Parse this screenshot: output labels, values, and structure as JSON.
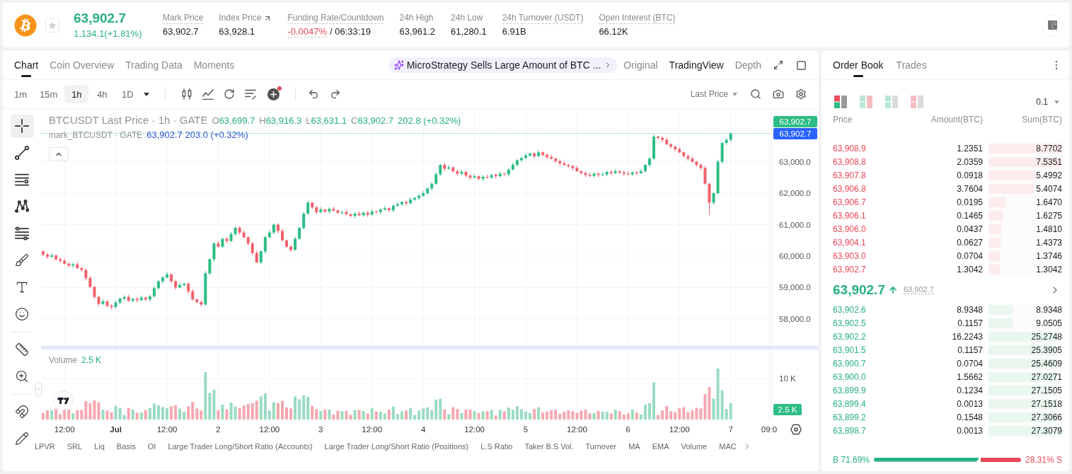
{
  "ticker": {
    "starred": false,
    "price": "63,902.7",
    "change": "1,134.1(+1.81%)",
    "stats": [
      {
        "label": "Mark Price",
        "value": "63,902.7",
        "kind": "tooltip"
      },
      {
        "label": "Index Price",
        "value": "63,928.1",
        "kind": "link"
      },
      {
        "label": "Funding Rate/Countdown",
        "value": "-0.0047%",
        "countdown": "/ 06:33:19",
        "kind": "funding"
      },
      {
        "label": "24h High",
        "value": "63,961.2",
        "kind": "plain"
      },
      {
        "label": "24h Low",
        "value": "61,280.1",
        "kind": "plain"
      },
      {
        "label": "24h Turnover (USDT)",
        "value": "6.91B",
        "kind": "tooltip"
      },
      {
        "label": "Open Interest (BTC)",
        "value": "66.12K",
        "kind": "tooltip"
      }
    ]
  },
  "chart_panel": {
    "tabs": [
      {
        "label": "Chart",
        "selected": true
      },
      {
        "label": "Coin Overview",
        "selected": false
      },
      {
        "label": "Trading Data",
        "selected": false
      },
      {
        "label": "Moments",
        "selected": false
      }
    ],
    "news": "MicroStrategy Sells Large Amount of BTC ...",
    "views": [
      {
        "label": "Original",
        "selected": false
      },
      {
        "label": "TradingView",
        "selected": true
      },
      {
        "label": "Depth",
        "selected": false
      }
    ]
  },
  "toolbar": {
    "intervals": [
      {
        "label": "1m",
        "selected": false
      },
      {
        "label": "15m",
        "selected": false
      },
      {
        "label": "1h",
        "selected": true
      },
      {
        "label": "4h",
        "selected": false
      },
      {
        "label": "1D",
        "selected": false
      }
    ],
    "new_badge": true,
    "price_source": "Last Price"
  },
  "drawing_tool_groups": [
    {
      "tools": [
        {
          "selected": true
        },
        {
          "selected": false
        },
        {
          "selected": false
        },
        {
          "selected": false
        },
        {
          "selected": false
        },
        {
          "selected": false
        },
        {
          "selected": false
        },
        {
          "selected": false
        }
      ]
    },
    {
      "tools": [
        {
          "selected": false
        },
        {
          "selected": false
        }
      ]
    },
    {
      "tools": [
        {
          "selected": false
        },
        {
          "selected": false
        }
      ]
    }
  ],
  "legend": {
    "title": "BTCUSDT Last Price · 1h · GATE",
    "ohlc": [
      {
        "key": "O",
        "value": "63,699.7"
      },
      {
        "key": "H",
        "value": "63,916.3"
      },
      {
        "key": "L",
        "value": "63,631.1"
      },
      {
        "key": "C",
        "value": "63,902.7"
      }
    ],
    "change": "202.8 (+0.32%)",
    "mark_title": "mark_BTCUSDT · GATE",
    "mark_values": "63,902.7 203.0 (+0.32%)"
  },
  "price_chart": {
    "chart_data": {
      "type": "candlestick",
      "categories": [
        null,
        null,
        null,
        null,
        null,
        "12:00",
        null,
        null,
        null,
        null,
        null,
        null,
        null,
        null,
        null,
        null,
        null,
        "Jul",
        null,
        null,
        null,
        null,
        null,
        null,
        null,
        null,
        null,
        null,
        null,
        "12:00",
        null,
        null,
        null,
        null,
        null,
        null,
        null,
        null,
        null,
        null,
        null,
        "2",
        null,
        null,
        null,
        null,
        null,
        null,
        null,
        null,
        null,
        null,
        null,
        "12:00",
        null,
        null,
        null,
        null,
        null,
        null,
        null,
        null,
        null,
        null,
        null,
        "3",
        null,
        null,
        null,
        null,
        null,
        null,
        null,
        null,
        null,
        null,
        null,
        "12:00",
        null,
        null,
        null,
        null,
        null,
        null,
        null,
        null,
        null,
        null,
        null,
        "4",
        null,
        null,
        null,
        null,
        null,
        null,
        null,
        null,
        null,
        null,
        null,
        "12:00",
        null,
        null,
        null,
        null,
        null,
        null,
        null,
        null,
        null,
        null,
        null,
        "5",
        null,
        null,
        null,
        null,
        null,
        null,
        null,
        null,
        null,
        null,
        null,
        "12:00",
        null,
        null,
        null,
        null,
        null,
        null,
        null,
        null,
        null,
        null,
        null,
        "6",
        null,
        null,
        null,
        null,
        null,
        null,
        null,
        null,
        null,
        null,
        null,
        "12:00",
        null,
        null,
        null,
        null,
        null,
        null,
        null,
        null,
        null,
        null,
        null,
        "7",
        null,
        null,
        null,
        null,
        null,
        null,
        null,
        null,
        "09:0"
      ],
      "ohlc": [
        [
          60150,
          60180,
          60000,
          60050
        ],
        [
          60050,
          60100,
          59910,
          59980
        ],
        [
          59980,
          60090,
          59950,
          60020
        ],
        [
          60020,
          60050,
          59850,
          59900
        ],
        [
          59900,
          59950,
          59780,
          59850
        ],
        [
          59850,
          59920,
          59730,
          59760
        ],
        [
          59760,
          59790,
          59650,
          59700
        ],
        [
          59700,
          59790,
          59630,
          59740
        ],
        [
          59740,
          59810,
          59590,
          59620
        ],
        [
          59620,
          59650,
          59510,
          59560
        ],
        [
          59560,
          59610,
          59230,
          59300
        ],
        [
          59300,
          59370,
          58990,
          59020
        ],
        [
          59020,
          59050,
          58650,
          58700
        ],
        [
          58700,
          58750,
          58410,
          58480
        ],
        [
          58480,
          58630,
          58450,
          58560
        ],
        [
          58560,
          58590,
          58370,
          58420
        ],
        [
          58420,
          58470,
          58310,
          58380
        ],
        [
          58380,
          58590,
          58350,
          58520
        ],
        [
          58520,
          58680,
          58470,
          58650
        ],
        [
          58650,
          58750,
          58580,
          58700
        ],
        [
          58700,
          58770,
          58550,
          58580
        ],
        [
          58580,
          58670,
          58530,
          58640
        ],
        [
          58640,
          58690,
          58530,
          58600
        ],
        [
          58600,
          58750,
          58570,
          58680
        ],
        [
          58680,
          58710,
          58570,
          58620
        ],
        [
          58620,
          58770,
          58550,
          58720
        ],
        [
          58720,
          59050,
          58690,
          58980
        ],
        [
          58980,
          59230,
          58930,
          59200
        ],
        [
          59200,
          59370,
          59130,
          59320
        ],
        [
          59320,
          59490,
          59290,
          59420
        ],
        [
          59420,
          59450,
          59150,
          59200
        ],
        [
          59200,
          59250,
          58930,
          59000
        ],
        [
          59000,
          59150,
          58970,
          59080
        ],
        [
          59080,
          59150,
          59030,
          59120
        ],
        [
          59120,
          59170,
          58810,
          58880
        ],
        [
          58880,
          58950,
          58590,
          58620
        ],
        [
          58620,
          58650,
          58490,
          58540
        ],
        [
          58540,
          58590,
          58390,
          58460
        ],
        [
          58460,
          59520,
          58430,
          59450
        ],
        [
          59450,
          59930,
          59400,
          59900
        ],
        [
          59900,
          60450,
          59830,
          60400
        ],
        [
          60400,
          60470,
          60270,
          60300
        ],
        [
          60300,
          60580,
          60250,
          60550
        ],
        [
          60550,
          60600,
          60410,
          60480
        ],
        [
          60480,
          60770,
          60450,
          60700
        ],
        [
          60700,
          60930,
          60650,
          60900
        ],
        [
          60900,
          60950,
          60680,
          60750
        ],
        [
          60750,
          60820,
          60570,
          60600
        ],
        [
          60600,
          60630,
          60350,
          60400
        ],
        [
          60400,
          60450,
          60030,
          60100
        ],
        [
          60100,
          60170,
          59770,
          59800
        ],
        [
          59800,
          60180,
          59750,
          60150
        ],
        [
          60150,
          60650,
          60080,
          60600
        ],
        [
          60600,
          60820,
          60570,
          60750
        ],
        [
          60750,
          61030,
          60700,
          61000
        ],
        [
          61000,
          61050,
          60730,
          60800
        ],
        [
          60800,
          60870,
          60470,
          60500
        ],
        [
          60500,
          60530,
          60250,
          60300
        ],
        [
          60300,
          60350,
          60130,
          60200
        ],
        [
          60200,
          60620,
          60170,
          60550
        ],
        [
          60550,
          60930,
          60500,
          60900
        ],
        [
          60900,
          61400,
          60830,
          61350
        ],
        [
          61350,
          61770,
          61320,
          61700
        ],
        [
          61700,
          61730,
          61500,
          61550
        ],
        [
          61550,
          61600,
          61330,
          61400
        ],
        [
          61400,
          61550,
          61370,
          61480
        ],
        [
          61480,
          61510,
          61370,
          61420
        ],
        [
          61420,
          61550,
          61350,
          61500
        ],
        [
          61500,
          61570,
          61420,
          61450
        ],
        [
          61450,
          61480,
          61330,
          61380
        ],
        [
          61380,
          61450,
          61310,
          61400
        ],
        [
          61400,
          61470,
          61300,
          61330
        ],
        [
          61330,
          61360,
          61230,
          61280
        ],
        [
          61280,
          61400,
          61210,
          61350
        ],
        [
          61350,
          61420,
          61270,
          61300
        ],
        [
          61300,
          61410,
          61250,
          61380
        ],
        [
          61380,
          61430,
          61250,
          61320
        ],
        [
          61320,
          61490,
          61290,
          61420
        ],
        [
          61420,
          61450,
          61350,
          61400
        ],
        [
          61400,
          61530,
          61330,
          61480
        ],
        [
          61480,
          61590,
          61450,
          61520
        ],
        [
          61520,
          61550,
          61410,
          61460
        ],
        [
          61460,
          61650,
          61390,
          61600
        ],
        [
          61600,
          61720,
          61570,
          61650
        ],
        [
          61650,
          61750,
          61600,
          61720
        ],
        [
          61720,
          61770,
          61610,
          61680
        ],
        [
          61680,
          61870,
          61650,
          61800
        ],
        [
          61800,
          61880,
          61750,
          61850
        ],
        [
          61850,
          61970,
          61780,
          61920
        ],
        [
          61920,
          62070,
          61890,
          62000
        ],
        [
          62000,
          62180,
          61950,
          62150
        ],
        [
          62150,
          62350,
          62080,
          62300
        ],
        [
          62300,
          62670,
          62270,
          62600
        ],
        [
          62600,
          62930,
          62550,
          62900
        ],
        [
          62900,
          62950,
          62710,
          62780
        ],
        [
          62780,
          62890,
          62750,
          62820
        ],
        [
          62820,
          62850,
          62650,
          62700
        ],
        [
          62700,
          62750,
          62550,
          62620
        ],
        [
          62620,
          62750,
          62590,
          62680
        ],
        [
          62680,
          62710,
          62510,
          62560
        ],
        [
          62560,
          62610,
          62430,
          62500
        ],
        [
          62500,
          62610,
          62470,
          62540
        ],
        [
          62540,
          62570,
          62410,
          62460
        ],
        [
          62460,
          62570,
          62390,
          62520
        ],
        [
          62520,
          62590,
          62470,
          62500
        ],
        [
          62500,
          62610,
          62450,
          62580
        ],
        [
          62580,
          62630,
          62470,
          62540
        ],
        [
          62540,
          62690,
          62510,
          62620
        ],
        [
          62620,
          62650,
          62550,
          62600
        ],
        [
          62600,
          62800,
          62530,
          62750
        ],
        [
          62750,
          62970,
          62720,
          62900
        ],
        [
          62900,
          63080,
          62850,
          63050
        ],
        [
          63050,
          63170,
          62980,
          63120
        ],
        [
          63120,
          63270,
          63090,
          63200
        ],
        [
          63200,
          63290,
          63150,
          63260
        ],
        [
          63260,
          63310,
          63110,
          63180
        ],
        [
          63180,
          63370,
          63150,
          63300
        ],
        [
          63300,
          63330,
          63170,
          63220
        ],
        [
          63220,
          63270,
          63080,
          63150
        ],
        [
          63150,
          63220,
          63070,
          63100
        ],
        [
          63100,
          63130,
          62970,
          63020
        ],
        [
          63020,
          63070,
          62880,
          62950
        ],
        [
          62950,
          63020,
          62870,
          62900
        ],
        [
          62900,
          62930,
          62810,
          62860
        ],
        [
          62860,
          62910,
          62730,
          62800
        ],
        [
          62800,
          62870,
          62670,
          62700
        ],
        [
          62700,
          62730,
          62590,
          62640
        ],
        [
          62640,
          62690,
          62510,
          62580
        ],
        [
          62580,
          62650,
          62520,
          62550
        ],
        [
          62550,
          62650,
          62500,
          62620
        ],
        [
          62620,
          62670,
          62510,
          62580
        ],
        [
          62580,
          62670,
          62550,
          62600
        ],
        [
          62600,
          62710,
          62550,
          62680
        ],
        [
          62680,
          62730,
          62570,
          62640
        ],
        [
          62640,
          62770,
          62610,
          62700
        ],
        [
          62700,
          62730,
          62610,
          62660
        ],
        [
          62660,
          62710,
          62550,
          62620
        ],
        [
          62620,
          62690,
          62570,
          62600
        ],
        [
          62600,
          62690,
          62550,
          62660
        ],
        [
          62660,
          62710,
          62570,
          62640
        ],
        [
          62640,
          62770,
          62610,
          62700
        ],
        [
          62700,
          62930,
          62650,
          62900
        ],
        [
          62900,
          63150,
          62830,
          63100
        ],
        [
          63100,
          63870,
          63070,
          63800
        ],
        [
          63800,
          63830,
          63710,
          63760
        ],
        [
          63760,
          63810,
          63630,
          63700
        ],
        [
          63700,
          63770,
          63530,
          63560
        ],
        [
          63560,
          63590,
          63430,
          63480
        ],
        [
          63480,
          63530,
          63330,
          63400
        ],
        [
          63400,
          63470,
          63270,
          63300
        ],
        [
          63300,
          63330,
          63130,
          63180
        ],
        [
          63180,
          63230,
          63030,
          63100
        ],
        [
          63100,
          63170,
          62970,
          63000
        ],
        [
          63000,
          63030,
          62850,
          62900
        ],
        [
          62900,
          62950,
          62730,
          62800
        ],
        [
          62800,
          62870,
          62270,
          62300
        ],
        [
          62300,
          62330,
          61300,
          61700
        ],
        [
          61700,
          62050,
          61630,
          62000
        ],
        [
          62000,
          63070,
          61970,
          63000
        ],
        [
          63000,
          63630,
          62950,
          63600
        ],
        [
          63600,
          63750,
          63530,
          63699.7
        ],
        [
          63699.7,
          63916.3,
          63631.1,
          63902.7
        ],
        null,
        null,
        null,
        null,
        null,
        null,
        null,
        null,
        null
      ],
      "ylim": [
        54780,
        64680
      ],
      "grid": true,
      "yticks": [
        {
          "value": 63000,
          "label": "63,000.0"
        },
        {
          "value": 62000,
          "label": "62,000.0"
        },
        {
          "value": 61000,
          "label": "61,000.0"
        },
        {
          "value": 60000,
          "label": "60,000.0"
        },
        {
          "value": 59000,
          "label": "59,000.0"
        },
        {
          "value": 58000,
          "label": "58,000.0"
        }
      ],
      "ref_lines": [
        {
          "axis": "y",
          "value": 63902.7,
          "label": "63,902.7"
        }
      ]
    },
    "x_label_emphasis": [
      false,
      true,
      false,
      false,
      false,
      false,
      false,
      false,
      false,
      false,
      false,
      false,
      false,
      false,
      false
    ]
  },
  "price_axis": {
    "mark_price": "63,902.7"
  },
  "volume": {
    "title": "Volume",
    "value": "2.5 K",
    "tick": "10 K",
    "last": "2.5 K"
  },
  "indicators": [
    "LPVR",
    "SRL",
    "Liq",
    "Basis",
    "OI",
    "Large Trader Long/Short Ratio (Accounts)",
    "Large Trader Long/Short Ratio (Positions)",
    "L.S Ratio",
    "Taker B.S Vol.",
    "Turnover",
    "MA",
    "EMA",
    "Volume",
    "MAC"
  ],
  "order_book": {
    "tabs": [
      {
        "label": "Order Book",
        "selected": true
      },
      {
        "label": "Trades",
        "selected": false
      }
    ],
    "layouts": [
      {
        "selected": true
      },
      {
        "selected": false
      },
      {
        "selected": false
      },
      {
        "selected": false
      }
    ],
    "precision": "0.1",
    "columns": [
      "Price",
      "Amount(BTC)",
      "Sum(BTC)"
    ],
    "asks": [
      {
        "price": "63,908.9",
        "amount": "1.2351",
        "sum": "8.7702",
        "level": 1.0
      },
      {
        "price": "63,908.8",
        "amount": "2.0359",
        "sum": "7.5351",
        "level": 1.0
      },
      {
        "price": "63,907.8",
        "amount": "0.0918",
        "sum": "5.4992",
        "level": 0.66
      },
      {
        "price": "63,906.8",
        "amount": "3.7604",
        "sum": "5.4074",
        "level": 0.62
      },
      {
        "price": "63,906.7",
        "amount": "0.0195",
        "sum": "1.6470",
        "level": 0.23
      },
      {
        "price": "63,906.1",
        "amount": "0.1465",
        "sum": "1.6275",
        "level": 0.19
      },
      {
        "price": "63,906.0",
        "amount": "0.0437",
        "sum": "1.4810",
        "level": 0.17
      },
      {
        "price": "63,904.1",
        "amount": "0.0627",
        "sum": "1.4373",
        "level": 0.16
      },
      {
        "price": "63,903.0",
        "amount": "0.0704",
        "sum": "1.3746",
        "level": 0.16
      },
      {
        "price": "63,902.7",
        "amount": "1.3042",
        "sum": "1.3042",
        "level": 0.15
      }
    ],
    "last": {
      "price": "63,902.7",
      "rising": true,
      "mark": "63,902.7"
    },
    "bids": [
      {
        "price": "63,902.6",
        "amount": "8.9348",
        "sum": "8.9348",
        "level": 0.33
      },
      {
        "price": "63,902.5",
        "amount": "0.1157",
        "sum": "9.0505",
        "level": 0.33
      },
      {
        "price": "63,902.2",
        "amount": "16.2243",
        "sum": "25.2748",
        "level": 0.93
      },
      {
        "price": "63,901.5",
        "amount": "0.1157",
        "sum": "25.3905",
        "level": 0.93
      },
      {
        "price": "63,900.7",
        "amount": "0.0704",
        "sum": "25.4609",
        "level": 0.93
      },
      {
        "price": "63,900.0",
        "amount": "1.5662",
        "sum": "27.0271",
        "level": 0.93
      },
      {
        "price": "63,899.9",
        "amount": "0.1234",
        "sum": "27.1505",
        "level": 0.93
      },
      {
        "price": "63,899.4",
        "amount": "0.0013",
        "sum": "27.1518",
        "level": 0.93
      },
      {
        "price": "63,899.2",
        "amount": "0.1548",
        "sum": "27.3066",
        "level": 0.93
      },
      {
        "price": "63,898.7",
        "amount": "0.0013",
        "sum": "27.3079",
        "level": 1.0
      }
    ],
    "ratio": {
      "buy": "B 71.69%",
      "sell": "28.31% S",
      "level": 0.7169
    }
  }
}
